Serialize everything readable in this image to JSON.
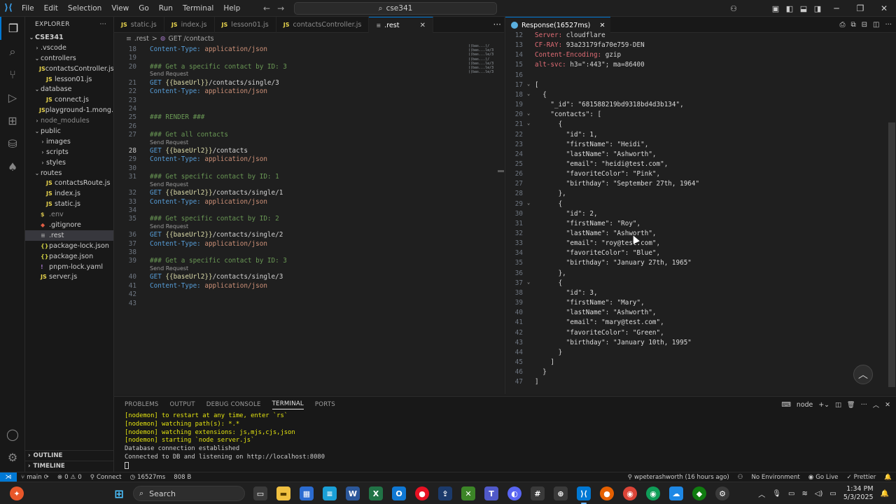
{
  "menu": [
    "File",
    "Edit",
    "Selection",
    "View",
    "Go",
    "Run",
    "Terminal",
    "Help"
  ],
  "search_title": "cse341",
  "sidebar": {
    "header": "EXPLORER",
    "items": [
      {
        "label": "CSE341",
        "depth": 0,
        "twist": "v",
        "icon": "",
        "bold": true
      },
      {
        "label": ".vscode",
        "depth": 1,
        "twist": ">",
        "icon": ""
      },
      {
        "label": "controllers",
        "depth": 1,
        "twist": "v",
        "icon": ""
      },
      {
        "label": "contactsController.js",
        "depth": 2,
        "twist": "",
        "icon": "JS"
      },
      {
        "label": "lesson01.js",
        "depth": 2,
        "twist": "",
        "icon": "JS"
      },
      {
        "label": "database",
        "depth": 1,
        "twist": "v",
        "icon": ""
      },
      {
        "label": "connect.js",
        "depth": 2,
        "twist": "",
        "icon": "JS"
      },
      {
        "label": "playground-1.mong...",
        "depth": 2,
        "twist": "",
        "icon": "JS"
      },
      {
        "label": "node_modules",
        "depth": 1,
        "twist": ">",
        "icon": "",
        "dim": true
      },
      {
        "label": "public",
        "depth": 1,
        "twist": "v",
        "icon": ""
      },
      {
        "label": "images",
        "depth": 2,
        "twist": ">",
        "icon": ""
      },
      {
        "label": "scripts",
        "depth": 2,
        "twist": ">",
        "icon": ""
      },
      {
        "label": "styles",
        "depth": 2,
        "twist": ">",
        "icon": ""
      },
      {
        "label": "routes",
        "depth": 1,
        "twist": "v",
        "icon": ""
      },
      {
        "label": "contactsRoute.js",
        "depth": 2,
        "twist": "",
        "icon": "JS"
      },
      {
        "label": "index.js",
        "depth": 2,
        "twist": "",
        "icon": "JS"
      },
      {
        "label": "static.js",
        "depth": 2,
        "twist": "",
        "icon": "JS"
      },
      {
        "label": ".env",
        "depth": 1,
        "twist": "",
        "icon": "$",
        "dim": true
      },
      {
        "label": ".gitignore",
        "depth": 1,
        "twist": "",
        "icon": "◆"
      },
      {
        "label": ".rest",
        "depth": 1,
        "twist": "",
        "icon": "≡",
        "selected": true
      },
      {
        "label": "package-lock.json",
        "depth": 1,
        "twist": "",
        "icon": "{}"
      },
      {
        "label": "package.json",
        "depth": 1,
        "twist": "",
        "icon": "{}"
      },
      {
        "label": "pnpm-lock.yaml",
        "depth": 1,
        "twist": "",
        "icon": "!"
      },
      {
        "label": "server.js",
        "depth": 1,
        "twist": "",
        "icon": "JS"
      }
    ],
    "outline": "OUTLINE",
    "timeline": "TIMELINE"
  },
  "tabs": [
    {
      "label": "static.js",
      "icon": "JS",
      "active": false
    },
    {
      "label": "index.js",
      "icon": "JS",
      "active": false
    },
    {
      "label": "lesson01.js",
      "icon": "JS",
      "active": false
    },
    {
      "label": "contactsController.js",
      "icon": "JS",
      "active": false
    },
    {
      "label": ".rest",
      "icon": "≡",
      "active": true
    }
  ],
  "breadcrumb": {
    "file": ".rest",
    "sep": ">",
    "section": "GET /contacts"
  },
  "editor": {
    "current_line": 28,
    "send_request": "Send Request",
    "lines": [
      {
        "n": 18,
        "kind": "header",
        "key": "Content-Type:",
        "value": " application/json"
      },
      {
        "n": 19,
        "kind": "blank"
      },
      {
        "n": 20,
        "kind": "comment",
        "text": "### Get a specific contact by ID: 3"
      },
      {
        "n": 21,
        "kind": "request",
        "method": "GET",
        "var": " {{baseUrl}}",
        "path": "/contacts/single/3",
        "lens": true
      },
      {
        "n": 22,
        "kind": "header",
        "key": "Content-Type:",
        "value": " application/json"
      },
      {
        "n": 23,
        "kind": "blank"
      },
      {
        "n": 24,
        "kind": "blank"
      },
      {
        "n": 25,
        "kind": "comment",
        "text": "### RENDER ###"
      },
      {
        "n": 26,
        "kind": "blank"
      },
      {
        "n": 27,
        "kind": "comment",
        "text": "### Get all contacts"
      },
      {
        "n": 28,
        "kind": "request",
        "method": "GET",
        "var": " {{baseUrl2}}",
        "path": "/contacts",
        "lens": true
      },
      {
        "n": 29,
        "kind": "header",
        "key": "Content-Type:",
        "value": " application/json"
      },
      {
        "n": 30,
        "kind": "blank"
      },
      {
        "n": 31,
        "kind": "comment",
        "text": "### Get specific contact by ID: 1"
      },
      {
        "n": 32,
        "kind": "request",
        "method": "GET",
        "var": " {{baseUrl2}}",
        "path": "/contacts/single/1",
        "lens": true
      },
      {
        "n": 33,
        "kind": "header",
        "key": "Content-Type:",
        "value": " application/json"
      },
      {
        "n": 34,
        "kind": "blank"
      },
      {
        "n": 35,
        "kind": "comment",
        "text": "### Get specific contact by ID: 2"
      },
      {
        "n": 36,
        "kind": "request",
        "method": "GET",
        "var": " {{baseUrl2}}",
        "path": "/contacts/single/2",
        "lens": true
      },
      {
        "n": 37,
        "kind": "header",
        "key": "Content-Type:",
        "value": " application/json"
      },
      {
        "n": 38,
        "kind": "blank"
      },
      {
        "n": 39,
        "kind": "comment",
        "text": "### Get a specific contact by ID: 3"
      },
      {
        "n": 40,
        "kind": "request",
        "method": "GET",
        "var": " {{baseUrl2}}",
        "path": "/contacts/single/3",
        "lens": true
      },
      {
        "n": 41,
        "kind": "header",
        "key": "Content-Type:",
        "value": " application/json"
      },
      {
        "n": 42,
        "kind": "blank"
      },
      {
        "n": 43,
        "kind": "blank"
      }
    ]
  },
  "response": {
    "tab_label": "Response(16527ms)",
    "lines": [
      {
        "n": 12,
        "t": "hdr",
        "key": "Server:",
        "val": " cloudflare"
      },
      {
        "n": 13,
        "t": "hdr",
        "key": "CF-RAY:",
        "val": " 93a23179fa70e759-DEN"
      },
      {
        "n": 14,
        "t": "hdr",
        "key": "Content-Encoding:",
        "val": " gzip"
      },
      {
        "n": 15,
        "t": "hdr",
        "key": "alt-svc:",
        "val": " h3=\":443\"; ma=86400"
      },
      {
        "n": 16,
        "t": "text",
        "text": ""
      },
      {
        "n": 17,
        "t": "text",
        "text": "[",
        "fold": true
      },
      {
        "n": 18,
        "t": "text",
        "text": "  {",
        "fold": true
      },
      {
        "n": 19,
        "t": "text",
        "text": "    \"_id\": \"681588219bd9318bd4d3b134\","
      },
      {
        "n": 20,
        "t": "text",
        "text": "    \"contacts\": [",
        "fold": true
      },
      {
        "n": 21,
        "t": "text",
        "text": "      {",
        "fold": true
      },
      {
        "n": 22,
        "t": "text",
        "text": "        \"id\": 1,"
      },
      {
        "n": 23,
        "t": "text",
        "text": "        \"firstName\": \"Heidi\","
      },
      {
        "n": 24,
        "t": "text",
        "text": "        \"lastName\": \"Ashworth\","
      },
      {
        "n": 25,
        "t": "text",
        "text": "        \"email\": \"heidi@test.com\","
      },
      {
        "n": 26,
        "t": "text",
        "text": "        \"favoriteColor\": \"Pink\","
      },
      {
        "n": 27,
        "t": "text",
        "text": "        \"birthday\": \"September 27th, 1964\""
      },
      {
        "n": 28,
        "t": "text",
        "text": "      },"
      },
      {
        "n": 29,
        "t": "text",
        "text": "      {",
        "fold": true
      },
      {
        "n": 30,
        "t": "text",
        "text": "        \"id\": 2,"
      },
      {
        "n": 31,
        "t": "text",
        "text": "        \"firstName\": \"Roy\","
      },
      {
        "n": 32,
        "t": "text",
        "text": "        \"lastName\": \"Ashworth\","
      },
      {
        "n": 33,
        "t": "text",
        "text": "        \"email\": \"roy@test.com\","
      },
      {
        "n": 34,
        "t": "text",
        "text": "        \"favoriteColor\": \"Blue\","
      },
      {
        "n": 35,
        "t": "text",
        "text": "        \"birthday\": \"January 27th, 1965\""
      },
      {
        "n": 36,
        "t": "text",
        "text": "      },"
      },
      {
        "n": 37,
        "t": "text",
        "text": "      {",
        "fold": true
      },
      {
        "n": 38,
        "t": "text",
        "text": "        \"id\": 3,"
      },
      {
        "n": 39,
        "t": "text",
        "text": "        \"firstName\": \"Mary\","
      },
      {
        "n": 40,
        "t": "text",
        "text": "        \"lastName\": \"Ashworth\","
      },
      {
        "n": 41,
        "t": "text",
        "text": "        \"email\": \"mary@test.com\","
      },
      {
        "n": 42,
        "t": "text",
        "text": "        \"favoriteColor\": \"Green\","
      },
      {
        "n": 43,
        "t": "text",
        "text": "        \"birthday\": \"January 10th, 1995\""
      },
      {
        "n": 44,
        "t": "text",
        "text": "      }"
      },
      {
        "n": 45,
        "t": "text",
        "text": "    ]"
      },
      {
        "n": 46,
        "t": "text",
        "text": "  }"
      },
      {
        "n": 47,
        "t": "text",
        "text": "]"
      }
    ]
  },
  "panel": {
    "tabs": [
      "PROBLEMS",
      "OUTPUT",
      "DEBUG CONSOLE",
      "TERMINAL",
      "PORTS"
    ],
    "active_tab": "TERMINAL",
    "terminal_name": "node",
    "lines": [
      {
        "text": "[nodemon] to restart at any time, enter `rs`",
        "color": "yellow"
      },
      {
        "text": "[nodemon] watching path(s): *.*",
        "color": "yellow"
      },
      {
        "text": "[nodemon] watching extensions: js,mjs,cjs,json",
        "color": "yellow"
      },
      {
        "text": "[nodemon] starting `node server.js`",
        "color": "yellow"
      },
      {
        "text": "Database connection established",
        "color": "white"
      },
      {
        "text": "Connected to DB and listening on http://localhost:8080",
        "color": "white"
      }
    ]
  },
  "statusbar": {
    "branch": "main",
    "errors": "0",
    "warnings": "0",
    "connect": "Connect",
    "timing": "16527ms",
    "size": "808 B",
    "blame": "wpeterashworth (16 hours ago)",
    "environment": "No Environment",
    "golive": "Go Live",
    "prettier": "Prettier"
  },
  "taskbar": {
    "search_label": "Search",
    "time": "1:34 PM",
    "date": "5/3/2025"
  }
}
